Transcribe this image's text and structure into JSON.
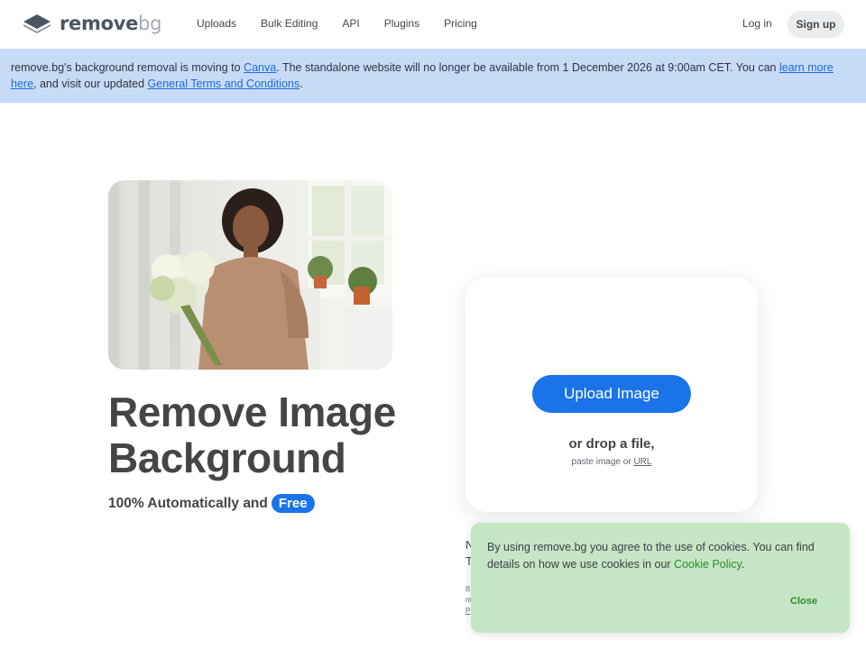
{
  "nav": {
    "logo_main": "remove",
    "logo_suffix": "bg",
    "links": [
      "Uploads",
      "Bulk Editing",
      "API",
      "Plugins",
      "Pricing"
    ],
    "login": "Log in",
    "signup": "Sign up"
  },
  "banner": {
    "text_1": "remove.bg's background removal is moving to ",
    "link_canva": "Canva",
    "text_2": ". The standalone website will no longer be available from 1 December 2026 at 9:00am CET. You can ",
    "link_learn": "learn more here",
    "text_3": ", and visit our updated ",
    "link_terms": "General Terms and Conditions",
    "text_4": "."
  },
  "hero": {
    "headline_line1": "Remove Image",
    "headline_line2": "Background",
    "subline": "100% Automatically and",
    "badge": "Free"
  },
  "upload": {
    "button": "Upload Image",
    "drop": "or drop a file,",
    "paste_prefix": "paste image or",
    "paste_url": "URL"
  },
  "behind": {
    "line1": "N",
    "line2": "T",
    "small1": "B",
    "small2": "m",
    "small3": "P"
  },
  "cookie": {
    "text_1": "By using remove.bg you agree to the use of cookies. You can find details on how we use cookies in our ",
    "link": "Cookie Policy",
    "text_2": ".",
    "close": "Close"
  },
  "colors": {
    "accent": "#1a73e8",
    "banner_bg": "#c7dbf7",
    "cookie_bg": "#c4e6c4",
    "cookie_link": "#2c8a2c"
  }
}
